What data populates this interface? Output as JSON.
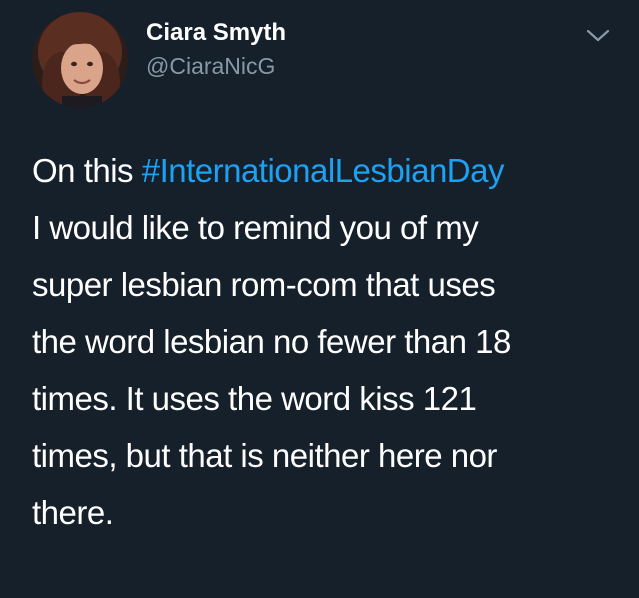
{
  "tweet": {
    "display_name": "Ciara Smyth",
    "handle": "@CiaraNicG",
    "text": {
      "line1_prefix": "On this ",
      "hashtag": "#InternationalLesbianDay",
      "lines": [
        "I would like to remind you of my",
        "super lesbian rom-com that uses",
        "the word lesbian no fewer than 18",
        "times. It uses the word kiss 121",
        "times, but that is neither here nor",
        "there."
      ]
    },
    "icons": {
      "menu": "chevron-down-icon",
      "avatar": "avatar"
    }
  },
  "colors": {
    "background": "#15202b",
    "text": "#ffffff",
    "secondary_text": "#8899a6",
    "link": "#1da1f2"
  }
}
